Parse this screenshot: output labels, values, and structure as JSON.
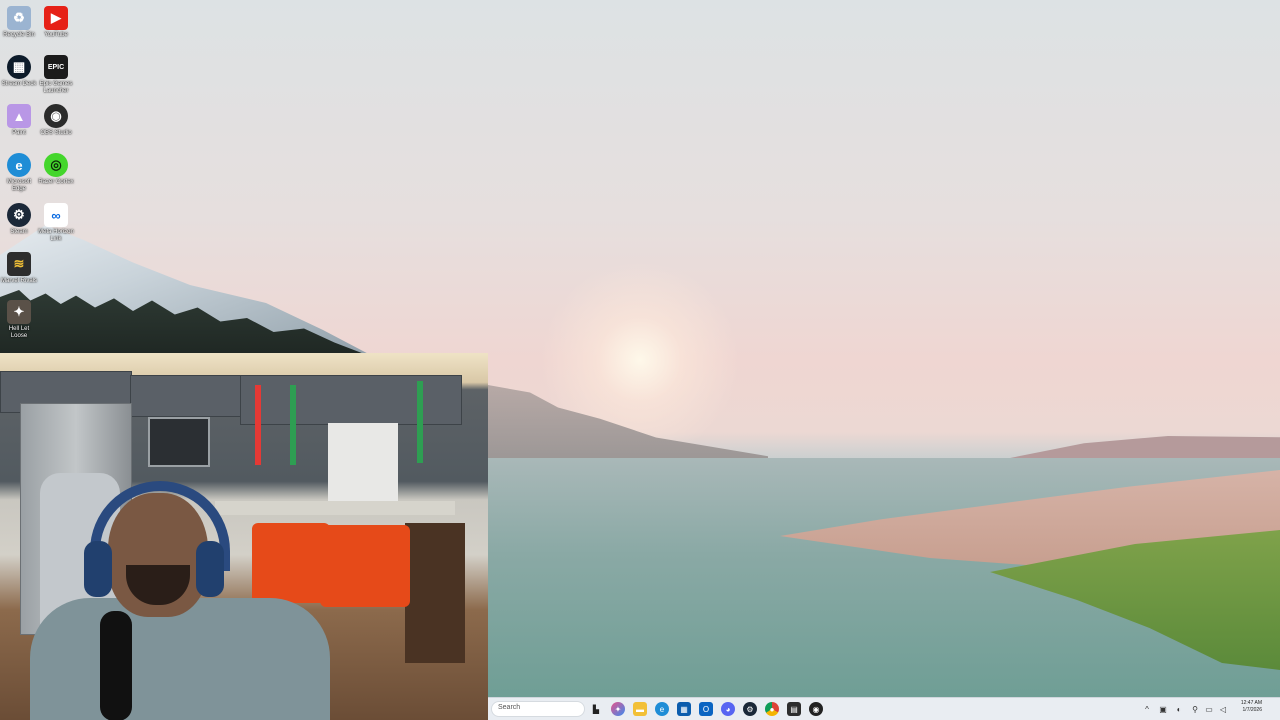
{
  "desktop": {
    "icons": [
      {
        "name": "Recycle Bin",
        "icon": "recycle-bin-icon",
        "color": "#9bb4d1"
      },
      {
        "name": "YouTube",
        "icon": "youtube-icon",
        "color": "#e62117"
      },
      {
        "name": "Stream Deck",
        "icon": "stream-deck-icon",
        "color": "#0d1b2a"
      },
      {
        "name": "Epic Games Launcher",
        "icon": "epic-games-icon",
        "color": "#1b1b1b"
      },
      {
        "name": "Paint",
        "icon": "paint-icon",
        "color": "#b997e6"
      },
      {
        "name": "OBS Studio",
        "icon": "obs-icon",
        "color": "#2b2b2b"
      },
      {
        "name": "Microsoft Edge",
        "icon": "edge-icon",
        "color": "#1f8dd6"
      },
      {
        "name": "Razer Cortex",
        "icon": "razer-icon",
        "color": "#44d62c"
      },
      {
        "name": "Steam",
        "icon": "steam-icon",
        "color": "#1b2838"
      },
      {
        "name": "Meta Horizon Link",
        "icon": "meta-icon",
        "color": "#ffffff"
      },
      {
        "name": "Marvel Rivals",
        "icon": "marvel-rivals-icon",
        "color": "#2d2d2d"
      },
      {
        "name": "Hell Let Loose",
        "icon": "hell-let-loose-icon",
        "color": "#5a5148"
      }
    ]
  },
  "taskbar": {
    "search_placeholder": "Search",
    "pinned": [
      {
        "icon": "file-explorer-icon",
        "color": "#222222"
      },
      {
        "icon": "copilot-icon",
        "color": "#e8548a"
      },
      {
        "icon": "folder-icon",
        "color": "#f2c037"
      },
      {
        "icon": "edge-icon",
        "color": "#1f8dd6"
      },
      {
        "icon": "calculator-icon",
        "color": "#0b5cad"
      },
      {
        "icon": "outlook-icon",
        "color": "#0a64c2"
      },
      {
        "icon": "discord-icon",
        "color": "#5865f2"
      },
      {
        "icon": "steam-icon",
        "color": "#1b2838"
      },
      {
        "icon": "chrome-icon",
        "color": "#db4437"
      },
      {
        "icon": "notepad-icon",
        "color": "#2d2d2d"
      },
      {
        "icon": "obs-recording-icon",
        "color": "#222222"
      }
    ],
    "tray": {
      "time": "12:47 AM",
      "date": "1/7/2026"
    }
  }
}
